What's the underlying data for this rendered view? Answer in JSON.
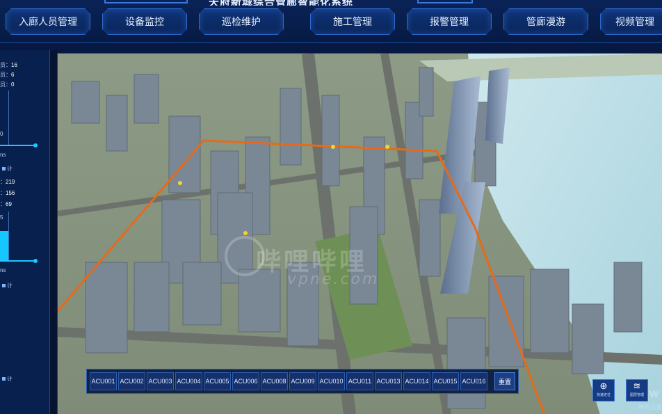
{
  "header": {
    "title": "天府新城综合管廊智能化系统",
    "nav": [
      {
        "label": "入廊人员管理"
      },
      {
        "label": "设备监控"
      },
      {
        "label": "巡检维护"
      },
      {
        "label": "施工管理"
      },
      {
        "label": "报警管理"
      },
      {
        "label": "管廊漫游"
      },
      {
        "label": "视频管理"
      }
    ]
  },
  "left_panel": {
    "stat1": {
      "label": "员：",
      "value": "16"
    },
    "stat2": {
      "label": "员：",
      "value": "6"
    },
    "stat3": {
      "label": "员：",
      "value": "0"
    },
    "tick_top": "0",
    "unit1": "ns",
    "legend1": "计",
    "val_a": {
      "label": "：",
      "value": "219"
    },
    "val_b": {
      "label": "：",
      "value": "156"
    },
    "val_c": {
      "label": "：",
      "value": "69"
    },
    "tick_mid": "5",
    "unit2": "ns",
    "legend2": "计",
    "legend3": "计",
    "bar_level": 0.7
  },
  "map": {
    "watermark_cn": "哔哩哔哩",
    "watermark_en": "vpne.com"
  },
  "acu_bar": {
    "items": [
      "ACU001",
      "ACU002",
      "ACU003",
      "ACU004",
      "ACU005",
      "ACU006",
      "ACU008",
      "ACU009",
      "ACU010",
      "ACU011",
      "ACU013",
      "ACU014",
      "ACU015",
      "ACU016"
    ],
    "reset_label": "重置"
  },
  "tools": {
    "locate_label": "快速定位",
    "layer_label": "图层管理",
    "corner_partial": "W",
    "corner_text": "转到'设置"
  },
  "colors": {
    "accent": "#2e6ad0",
    "route": "#e66a1a",
    "cyan": "#20c6ff"
  }
}
